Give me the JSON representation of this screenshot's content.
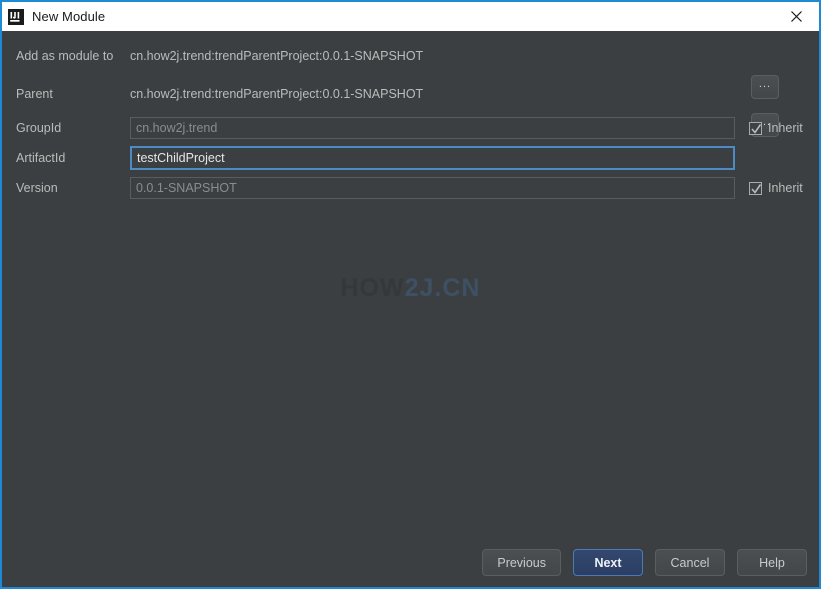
{
  "window": {
    "title": "New Module",
    "app_icon": "intellij-idea-icon",
    "close_icon": "close-icon",
    "border_color": "#1e8ad6",
    "titlebar_bg": "#ffffff",
    "dialog_bg": "#3c3f41"
  },
  "form": {
    "rows": [
      {
        "label": "Add as module to",
        "type": "static",
        "value": "cn.how2j.trend:trendParentProject:0.0.1-SNAPSHOT",
        "browse_label": "...",
        "has_browse": true
      },
      {
        "label": "Parent",
        "type": "static",
        "value": "cn.how2j.trend:trendParentProject:0.0.1-SNAPSHOT",
        "browse_label": "...",
        "has_browse": true
      },
      {
        "label": "GroupId",
        "type": "input",
        "value": "cn.how2j.trend",
        "placeholder": "",
        "focused": false,
        "inherit_label": "Inherit",
        "inherit_checked": true
      },
      {
        "label": "ArtifactId",
        "type": "input",
        "value": "testChildProject",
        "placeholder": "",
        "focused": true,
        "inherit_label": "",
        "inherit_checked": false
      },
      {
        "label": "Version",
        "type": "input",
        "value": "0.0.1-SNAPSHOT",
        "placeholder": "",
        "focused": false,
        "inherit_label": "Inherit",
        "inherit_checked": true
      }
    ]
  },
  "watermark": {
    "part1": "HOW",
    "part2": "2J.CN",
    "color1": "#34383a",
    "color2": "#3e5064"
  },
  "footer": {
    "previous_label": "Previous",
    "next_label": "Next",
    "cancel_label": "Cancel",
    "help_label": "Help",
    "default_button": "Next",
    "default_button_color": "#2f4469"
  }
}
